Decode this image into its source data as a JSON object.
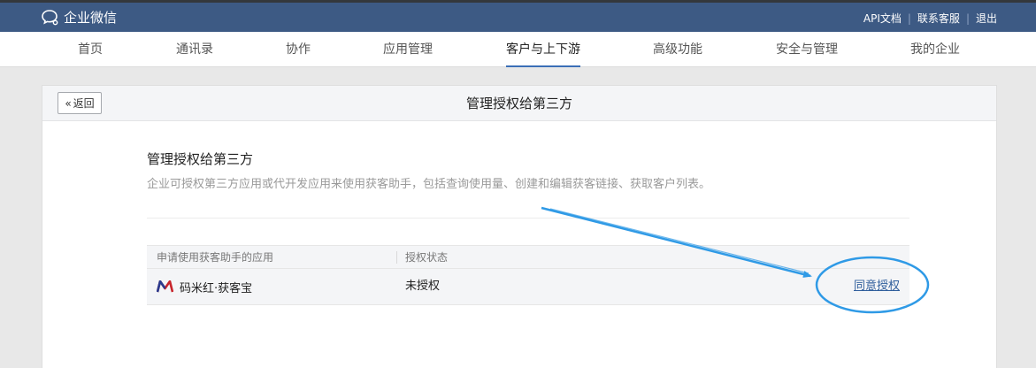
{
  "header": {
    "brand": "企业微信",
    "links": [
      {
        "label": "API文档"
      },
      {
        "label": "联系客服"
      },
      {
        "label": "退出"
      }
    ]
  },
  "nav": {
    "items": [
      {
        "label": "首页"
      },
      {
        "label": "通讯录"
      },
      {
        "label": "协作"
      },
      {
        "label": "应用管理"
      },
      {
        "label": "客户与上下游"
      },
      {
        "label": "高级功能"
      },
      {
        "label": "安全与管理"
      },
      {
        "label": "我的企业"
      }
    ],
    "active_index": 4
  },
  "panel": {
    "back_label": "返回",
    "title": "管理授权给第三方",
    "section_title": "管理授权给第三方",
    "section_desc": "企业可授权第三方应用或代开发应用来使用获客助手，包括查询使用量、创建和编辑获客链接、获取客户列表。"
  },
  "table": {
    "headers": [
      "申请使用获客助手的应用",
      "授权状态"
    ],
    "rows": [
      {
        "app_name": "码米红·获客宝",
        "status": "未授权",
        "action": "同意授权"
      }
    ]
  },
  "colors": {
    "topbar": "#3d5a84",
    "accent": "#3b6eb6",
    "annotation": "#2f9ae6",
    "link": "#2f5e9c"
  }
}
